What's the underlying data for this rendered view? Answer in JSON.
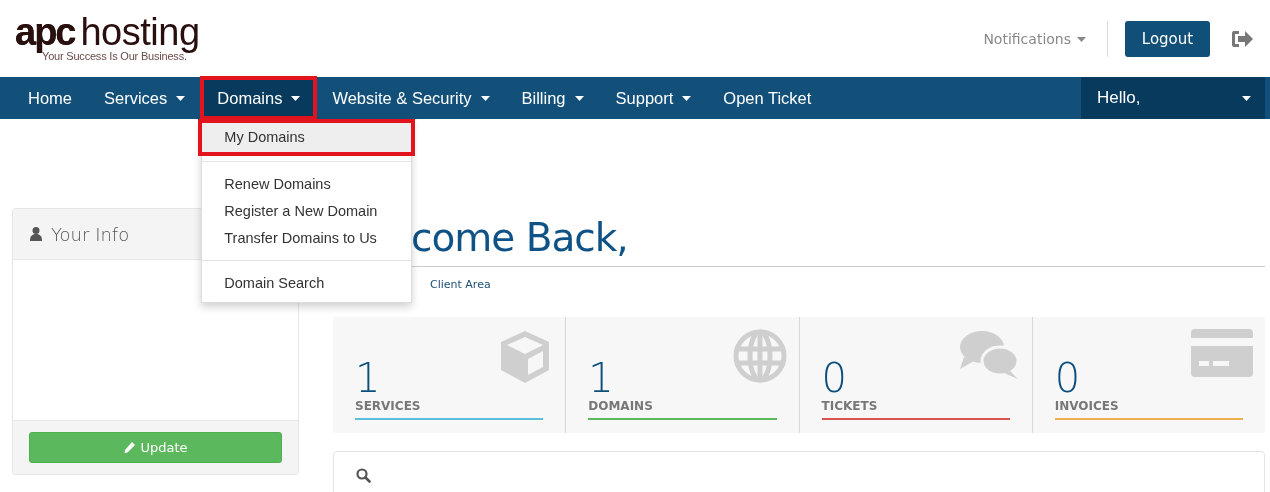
{
  "logo": {
    "brand": "apc",
    "name": "hosting",
    "tagline": "Your Success Is Our Business."
  },
  "header": {
    "notifications": "Notifications",
    "logout": "Logout"
  },
  "nav": {
    "items": [
      {
        "label": "Home",
        "dropdown": false,
        "selected": false,
        "highlighted": false
      },
      {
        "label": "Services",
        "dropdown": true,
        "selected": false,
        "highlighted": false
      },
      {
        "label": "Domains",
        "dropdown": true,
        "selected": true,
        "highlighted": true
      },
      {
        "label": "Website & Security",
        "dropdown": true,
        "selected": false,
        "highlighted": false
      },
      {
        "label": "Billing",
        "dropdown": true,
        "selected": false,
        "highlighted": false
      },
      {
        "label": "Support",
        "dropdown": true,
        "selected": false,
        "highlighted": false
      },
      {
        "label": "Open Ticket",
        "dropdown": false,
        "selected": false,
        "highlighted": false
      }
    ],
    "user": {
      "label": "Hello,"
    }
  },
  "dropdown": {
    "items": [
      {
        "kind": "item",
        "label": "My Domains",
        "selected": true,
        "highlighted": true
      },
      {
        "kind": "divider"
      },
      {
        "kind": "item",
        "label": "Renew Domains",
        "selected": false,
        "highlighted": false
      },
      {
        "kind": "item",
        "label": "Register a New Domain",
        "selected": false,
        "highlighted": false
      },
      {
        "kind": "item",
        "label": "Transfer Domains to Us",
        "selected": false,
        "highlighted": false
      },
      {
        "kind": "divider"
      },
      {
        "kind": "item",
        "label": "Domain Search",
        "selected": false,
        "highlighted": false
      }
    ]
  },
  "sidebar": {
    "title": "Your Info",
    "button": "Update"
  },
  "main": {
    "heading": "come Back,",
    "breadcrumb": "Client Area",
    "stats": [
      {
        "count": "1",
        "label": "SERVICES",
        "color": "#5bc0de",
        "kind": "box"
      },
      {
        "count": "1",
        "label": "DOMAINS",
        "color": "#5cb85c",
        "kind": "globe"
      },
      {
        "count": "0",
        "label": "TICKETS",
        "color": "#d9534f",
        "kind": "chat"
      },
      {
        "count": "0",
        "label": "INVOICES",
        "color": "#f0ad4e",
        "kind": "card"
      }
    ]
  }
}
